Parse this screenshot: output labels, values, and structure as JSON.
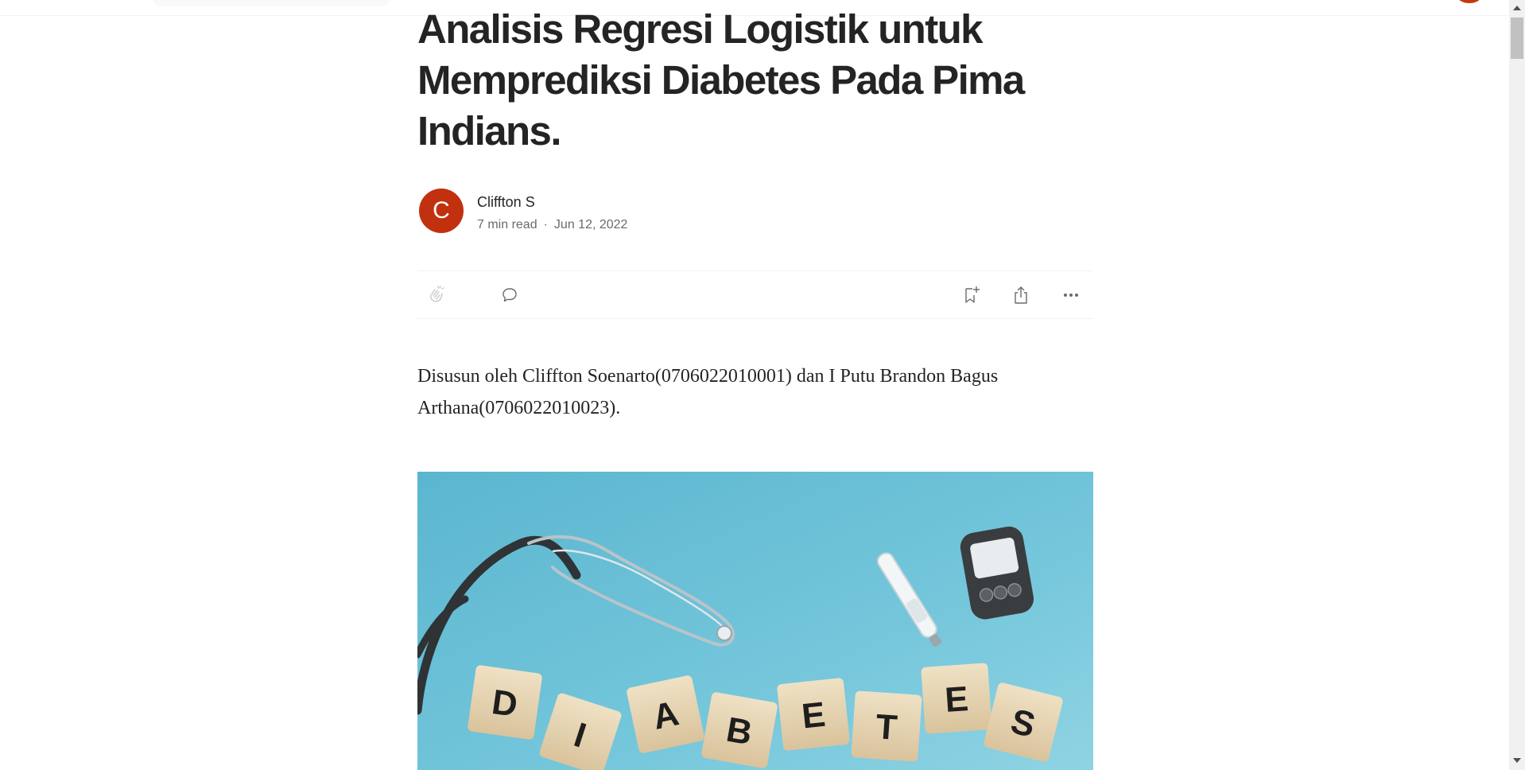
{
  "article": {
    "title": "Analisis Regresi Logistik untuk Memprediksi Diabetes Pada Pima Indians.",
    "author": {
      "name": "Cliffton S",
      "avatar_letter": "C",
      "avatar_color": "#c1310f"
    },
    "read_time": "7 min read",
    "separator": "·",
    "date": "Jun 12, 2022",
    "intro": "Disusun oleh Cliffton Soenarto(0706022010001) dan I Putu Brandon Bagus Arthana(0706022010023).",
    "hero_image": {
      "letters": [
        "D",
        "I",
        "A",
        "B",
        "E",
        "T",
        "E",
        "S"
      ],
      "background_color": "#6cc3d9"
    }
  },
  "action_bar": {
    "icons": [
      "clap-icon",
      "comment-icon",
      "bookmark-add-icon",
      "share-icon",
      "more-icon"
    ]
  }
}
